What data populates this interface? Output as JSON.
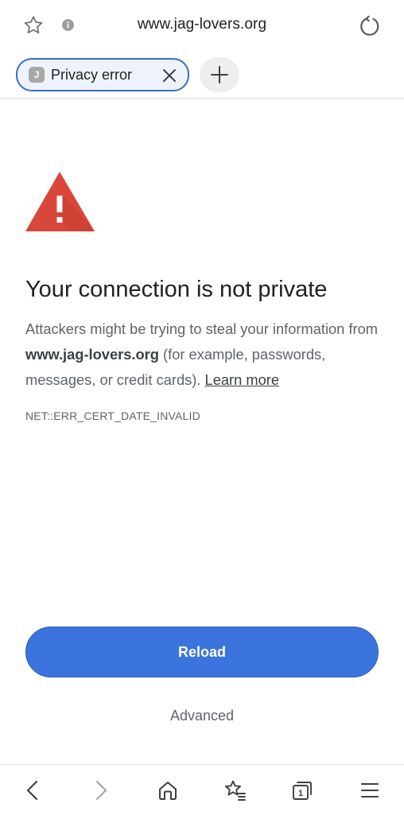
{
  "address_bar": {
    "url": "www.jag-lovers.org",
    "icons": [
      "star-icon",
      "info-icon",
      "reload-icon"
    ]
  },
  "tabs": {
    "active_tab": {
      "favicon_letter": "J",
      "title": "Privacy error"
    },
    "new_tab_icon": "plus-icon"
  },
  "content": {
    "warning_icon": "warning-triangle-icon",
    "headline": "Your connection is not private",
    "description_part1": "Attackers might be trying to steal your information from ",
    "description_domain": "www.jag-lovers.org",
    "description_part2": " (for example, passwords, messages, or credit cards). ",
    "learn_more": "Learn more",
    "error_code": "NET::ERR_CERT_DATE_INVALID",
    "reload_label": "Reload",
    "advanced_label": "Advanced"
  },
  "bottom_bar": {
    "items": [
      "back-icon",
      "forward-icon",
      "home-icon",
      "bookmarks-icon",
      "tabs-icon",
      "menu-icon"
    ],
    "tab_count": "1"
  },
  "colors": {
    "accent": "#3b74dd",
    "warning": "#d9473b",
    "text_primary": "#202124",
    "text_secondary": "#5f6368"
  }
}
